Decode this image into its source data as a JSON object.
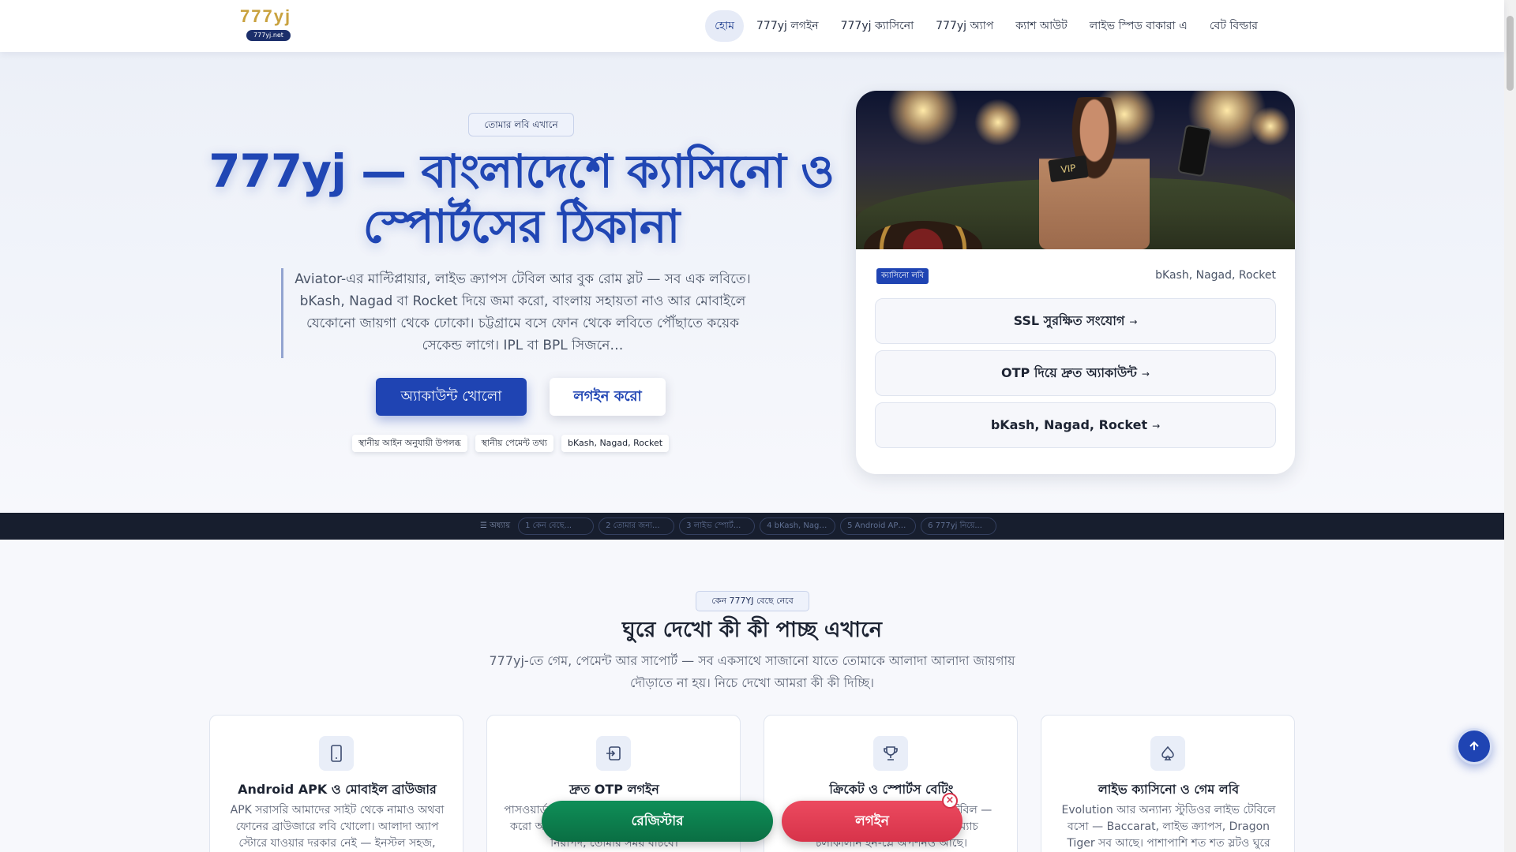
{
  "header": {
    "logo_text": "777yj",
    "logo_sub": "777yj.net",
    "nav": [
      {
        "label": "হোম",
        "active": true
      },
      {
        "label": "777yj লগইন"
      },
      {
        "label": "777yj ক্যাসিনো"
      },
      {
        "label": "777yj অ্যাপ"
      },
      {
        "label": "ক্যাশ আউট"
      },
      {
        "label": "লাইভ স্পিড বাকারা এ"
      },
      {
        "label": "বেট বিল্ডার"
      }
    ]
  },
  "hero": {
    "tag": "তোমার লবি এখানে",
    "title": "777yj — বাংলাদেশে ক্যাসিনো ও স্পোর্টসের ঠিকানা",
    "description": "Aviator-এর মাল্টিপ্লায়ার, লাইভ ক্র্যাপস টেবিল আর বুক রোম স্লট — সব এক লবিতে। bKash, Nagad বা Rocket দিয়ে জমা করো, বাংলায় সহায়তা নাও আর মোবাইলে যেকোনো জায়গা থেকে ঢোকো। চট্টগ্রামে বসে ফোন থেকে লবিতে পৌঁছাতে কয়েক সেকেন্ড লাগে। IPL বা BPL সিজনে…",
    "primary_button": "অ্যাকাউন্ট খোলো",
    "secondary_button": "লগইন করো",
    "chips": [
      "স্থানীয় আইন অনুযায়ী উপলব্ধ",
      "স্থানীয় পেমেন্ট তথ্য",
      "bKash, Nagad, Rocket"
    ]
  },
  "hero_card": {
    "image_vip_text": "VIP",
    "badge": "ক্যাসিনো লবি",
    "payments": "bKash, Nagad, Rocket",
    "rows": [
      "SSL সুরক্ষিত সংযোগ",
      "OTP দিয়ে দ্রুত অ্যাকাউন্ট",
      "bKash, Nagad, Rocket"
    ],
    "row_arrow": "→"
  },
  "chapter_strip": {
    "label": "☰ অধ্যায়",
    "items": [
      "1 কেন বেছে...",
      "2 তোমার জন্য...",
      "3 লাইভ স্পোর্ট...",
      "4 bKash, Naga...",
      "5 Android APK...",
      "6 777yj নিয়ে..."
    ]
  },
  "features_section": {
    "tag": "কেন 777YJ বেছে নেবে",
    "title": "ঘুরে দেখো কী কী পাচ্ছ এখানে",
    "description": "777yj-তে গেম, পেমেন্ট আর সাপোর্ট — সব একসাথে সাজানো যাতে তোমাকে আলাদা আলাদা জায়গায় দৌড়াতে না হয়। নিচে দেখো আমরা কী কী দিচ্ছি।",
    "cards": [
      {
        "icon": "phone-icon",
        "title": "Android APK ও মোবাইল ব্রাউজার",
        "desc": "APK সরাসরি আমাদের সাইট থেকে নামাও অথবা ফোনের ব্রাউজারে লবি খোলো। আলাদা অ্যাপ স্টোরে যাওয়ার দরকার নেই — ইনস্টল সহজ,"
      },
      {
        "icon": "login-icon",
        "title": "দ্রুত OTP লগইন",
        "desc": "পাসওয়ার্ড মনে রাখার ঝামেলা নেই। OTP অনুরোধ করো আর সাথে সাথে ঢুকে পড়ো। প্রতিটা সেশন নিরাপদ, তোমার সময় বাঁচবে।"
      },
      {
        "icon": "trophy-icon",
        "title": "ক্রিকেট ও স্পোর্টস বেটিং",
        "desc": "IPL, BPL আর আন্তর্জাতিক ম্যাচের টেবিল — লাইভ অডস আর বেট বিল্ডার দিয়ে ম্যাচ চলাকালীন ইন-প্লে অপশনও আছে।"
      },
      {
        "icon": "spade-icon",
        "title": "লাইভ ক্যাসিনো ও গেম লবি",
        "desc": "Evolution আর অন্যান্য স্টুডিওর লাইভ টেবিলে বসো — Baccarat, লাইভ ক্র্যাপস, Dragon Tiger সব আছে। পাশাপাশি শত শত স্লটও ঘুরে"
      }
    ]
  },
  "floating": {
    "register": "রেজিস্টার",
    "login": "লগইন",
    "close": "×"
  },
  "colors": {
    "primary": "#1f44b3",
    "register_green": "#0f8f58",
    "login_red": "#d7334a",
    "strip_dark": "#171e2e"
  }
}
